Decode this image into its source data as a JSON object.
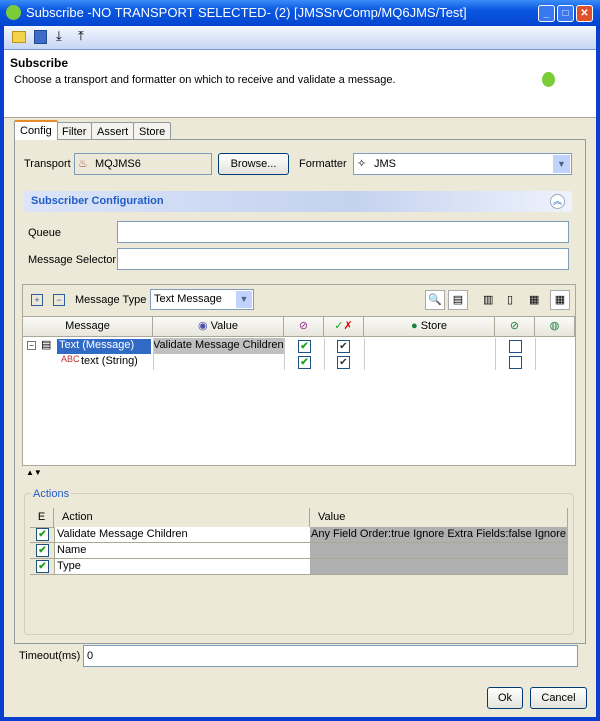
{
  "window": {
    "title": "Subscribe -NO TRANSPORT SELECTED- (2) [JMSSrvComp/MQ6JMS/Test]",
    "min": "_",
    "max": "□",
    "close": "✕"
  },
  "header": {
    "title": "Subscribe",
    "description": "Choose a transport and formatter on which to receive and validate a message."
  },
  "tabs": [
    {
      "label": "Config"
    },
    {
      "label": "Filter"
    },
    {
      "label": "Assert"
    },
    {
      "label": "Store"
    }
  ],
  "config": {
    "transport_label": "Transport",
    "transport_value": "MQJMS6",
    "browse": "Browse...",
    "formatter_label": "Formatter",
    "formatter_value": "JMS",
    "section_title": "Subscriber Configuration",
    "queue_label": "Queue",
    "queue_value": "",
    "selector_label": "Message Selector",
    "selector_value": ""
  },
  "message": {
    "type_label": "Message Type",
    "type_value": "Text Message",
    "columns": [
      "Message",
      "Value",
      "",
      "",
      "Store",
      "",
      ""
    ],
    "rows": [
      {
        "name": "Text (Message)",
        "value": "Validate Message Children",
        "c1": "✔",
        "c2": "✔",
        "store": "",
        "c3": ""
      },
      {
        "name": "text (String)",
        "value": "",
        "c1": "✔",
        "c2": "✔",
        "store": "",
        "c3": ""
      }
    ]
  },
  "actions": {
    "group_label": "Actions",
    "columns": [
      "E",
      "Action",
      "Value"
    ],
    "rows": [
      {
        "enabled": "✔",
        "action": "Validate Message Children",
        "value": "Any Field Order:true Ignore Extra Fields:false Ignore"
      },
      {
        "enabled": "✔",
        "action": "Name",
        "value": ""
      },
      {
        "enabled": "✔",
        "action": "Type",
        "value": ""
      }
    ]
  },
  "timeout": {
    "label": "Timeout(ms)",
    "value": "0"
  },
  "footer": {
    "ok": "Ok",
    "cancel": "Cancel"
  }
}
